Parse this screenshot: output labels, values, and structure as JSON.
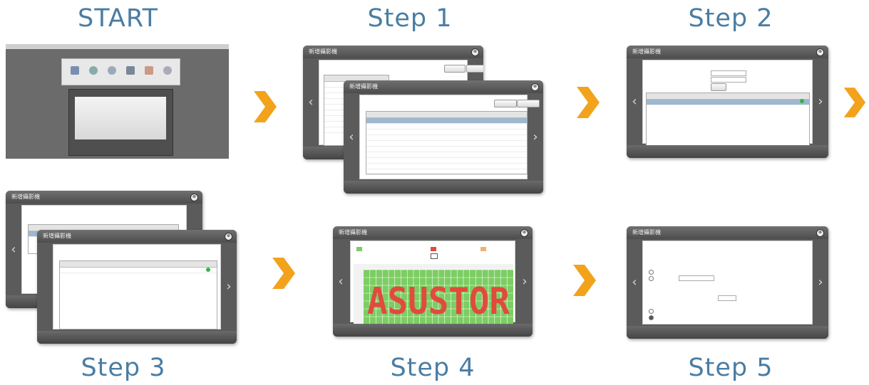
{
  "labels": {
    "start": "START",
    "step1": "Step 1",
    "step2": "Step 2",
    "step3": "Step 3",
    "step4": "Step 4",
    "step5": "Step 5"
  },
  "dialog": {
    "title": "新增攝影機",
    "close_glyph": "⊗",
    "prev_glyph": "‹",
    "next_glyph": "›"
  },
  "watermark": "ASUSTOR",
  "colors": {
    "label": "#4a7da3",
    "arrow": "#f2a31b",
    "schedule_green": "#7ccd63",
    "schedule_red": "#e04b3c",
    "status_green": "#32b44a"
  },
  "icons": {
    "next_arrow": "chevron-right-icon"
  }
}
